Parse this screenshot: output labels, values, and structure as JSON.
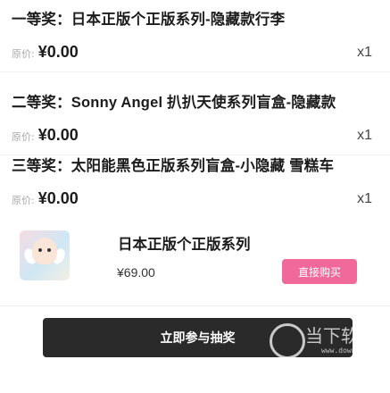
{
  "tiers": [
    {
      "title": "一等奖：日本正版个正版系列-隐藏款行李",
      "price_prefix": "原价:",
      "price": "¥0.00",
      "quantity": "x1"
    },
    {
      "title": "二等奖：Sonny Angel 扒扒天使系列盲盒-隐藏款",
      "price_prefix": "原价:",
      "price": "¥0.00",
      "quantity": "x1"
    },
    {
      "title": "三等奖：太阳能黑色正版系列盲盒-小隐藏 雪糕车",
      "price_prefix": "原价:",
      "price": "¥0.00",
      "quantity": "x1"
    }
  ],
  "product": {
    "image_icon": "angel-figure-thumbnail",
    "name": "日本正版个正版系列",
    "price": "¥69.00",
    "buy_label": "直接购买"
  },
  "join_label": "立即参与抽奖",
  "watermark": {
    "text": "当下软件园",
    "url": "www.downxia.com"
  },
  "colors": {
    "accent": "#f1689b",
    "join_bg": "#2a2a2a"
  }
}
